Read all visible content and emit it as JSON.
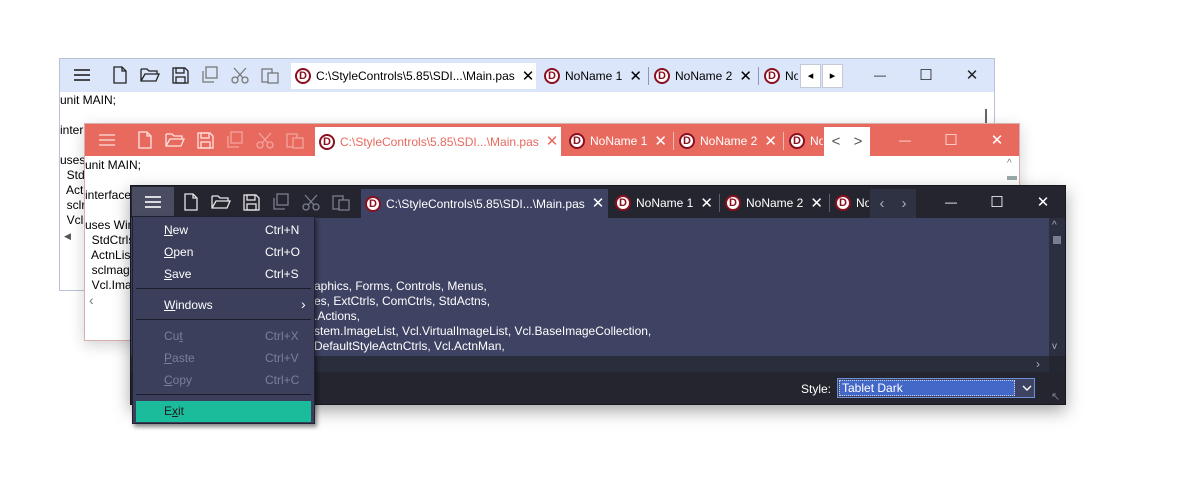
{
  "colors": {
    "win1_bar": "#dce6fb",
    "win2_bar": "#e8695e",
    "win3_bar": "#24252f",
    "editor_dark": "#3e4363",
    "menu_bg": "#3b3f5b",
    "exit_highlight": "#1abc9c"
  },
  "toolbar_icons": [
    "menu-icon",
    "new-file-icon",
    "open-folder-icon",
    "save-icon",
    "copy-icon",
    "cut-icon",
    "paste-icon"
  ],
  "win1": {
    "tabs": [
      {
        "label": "C:\\StyleControls\\5.85\\SDI...\\Main.pas"
      },
      {
        "label": "NoName 1"
      },
      {
        "label": "NoName 2"
      },
      {
        "label": "No"
      }
    ],
    "scroll_left": "◂",
    "scroll_right": "▸",
    "code": [
      "unit MAIN;",
      "",
      "inter"
    ]
  },
  "win2": {
    "tabs": [
      {
        "label": "C:\\StyleControls\\5.85\\SDI...\\Main.pas"
      },
      {
        "label": "NoName 1"
      },
      {
        "label": "NoName 2"
      },
      {
        "label": "No"
      }
    ],
    "scroll_left": "<",
    "scroll_right": ">",
    "code": [
      "unit MAIN;",
      "",
      "interface",
      "",
      "uses Win"
    ]
  },
  "win1_hidden_code": [
    "uses",
    "  Std",
    "  Actn",
    "  sclr",
    "  Vcl."
  ],
  "win2_hidden_code": [
    "  StdCtrls",
    "  ActnList",
    "  sclmage",
    "  Vcl.Imag"
  ],
  "win3": {
    "tabs": [
      {
        "label": "C:\\StyleControls\\5.85\\SDI...\\Main.pas"
      },
      {
        "label": "NoName 1"
      },
      {
        "label": "NoName 2"
      },
      {
        "label": "No"
      }
    ],
    "scroll_left": "‹",
    "scroll_right": "›",
    "code": [
      "aphics, Forms, Controls, Menus,",
      "es, ExtCtrls, ComCtrls, StdActns,",
      ".Actions,",
      "stem.ImageList, Vcl.VirtualImageList, Vcl.BaseImageCollection,",
      "DefaultStyleActnCtrls, Vcl.ActnMan,"
    ],
    "style_label": "Style:",
    "style_value": "Tablet Dark"
  },
  "window_controls": {
    "minimize": "—",
    "maximize": "☐",
    "close": "✕"
  },
  "menu": {
    "items": [
      {
        "label": "New",
        "accel": "N",
        "shortcut": "Ctrl+N",
        "enabled": true
      },
      {
        "label": "Open",
        "accel": "O",
        "shortcut": "Ctrl+O",
        "enabled": true
      },
      {
        "label": "Save",
        "accel": "S",
        "shortcut": "Ctrl+S",
        "enabled": true
      },
      {
        "label": "Windows",
        "accel": "W",
        "submenu_arrow": "›",
        "enabled": true
      },
      {
        "label": "Cut",
        "accel": "t",
        "shortcut": "Ctrl+X",
        "enabled": false
      },
      {
        "label": "Paste",
        "accel": "P",
        "shortcut": "Ctrl+V",
        "enabled": false
      },
      {
        "label": "Copy",
        "accel": "C",
        "shortcut": "Ctrl+C",
        "enabled": false
      },
      {
        "label": "Exit",
        "accel": "x",
        "enabled": true,
        "highlighted": true
      }
    ]
  }
}
